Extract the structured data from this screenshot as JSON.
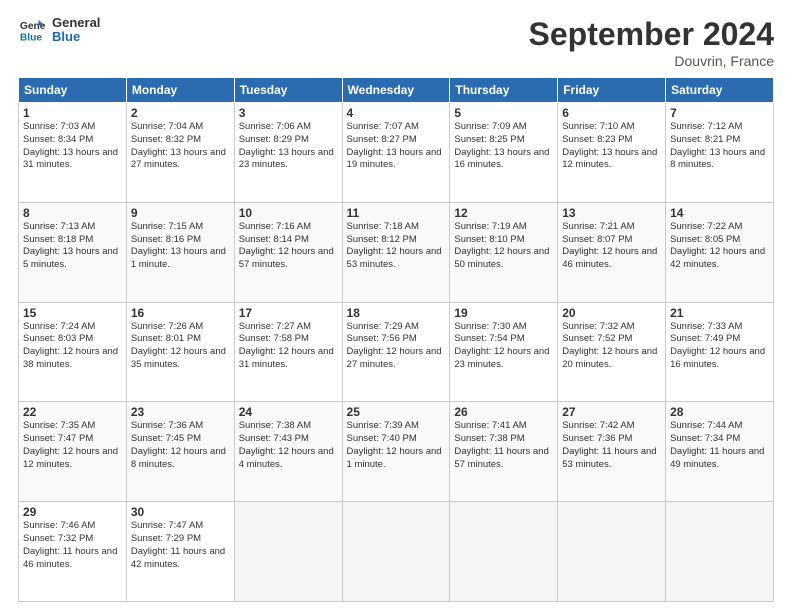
{
  "header": {
    "logo_line1": "General",
    "logo_line2": "Blue",
    "month": "September 2024",
    "location": "Douvrin, France"
  },
  "weekdays": [
    "Sunday",
    "Monday",
    "Tuesday",
    "Wednesday",
    "Thursday",
    "Friday",
    "Saturday"
  ],
  "weeks": [
    [
      {
        "day": "1",
        "sunrise": "Sunrise: 7:03 AM",
        "sunset": "Sunset: 8:34 PM",
        "daylight": "Daylight: 13 hours and 31 minutes."
      },
      {
        "day": "2",
        "sunrise": "Sunrise: 7:04 AM",
        "sunset": "Sunset: 8:32 PM",
        "daylight": "Daylight: 13 hours and 27 minutes."
      },
      {
        "day": "3",
        "sunrise": "Sunrise: 7:06 AM",
        "sunset": "Sunset: 8:29 PM",
        "daylight": "Daylight: 13 hours and 23 minutes."
      },
      {
        "day": "4",
        "sunrise": "Sunrise: 7:07 AM",
        "sunset": "Sunset: 8:27 PM",
        "daylight": "Daylight: 13 hours and 19 minutes."
      },
      {
        "day": "5",
        "sunrise": "Sunrise: 7:09 AM",
        "sunset": "Sunset: 8:25 PM",
        "daylight": "Daylight: 13 hours and 16 minutes."
      },
      {
        "day": "6",
        "sunrise": "Sunrise: 7:10 AM",
        "sunset": "Sunset: 8:23 PM",
        "daylight": "Daylight: 13 hours and 12 minutes."
      },
      {
        "day": "7",
        "sunrise": "Sunrise: 7:12 AM",
        "sunset": "Sunset: 8:21 PM",
        "daylight": "Daylight: 13 hours and 8 minutes."
      }
    ],
    [
      {
        "day": "8",
        "sunrise": "Sunrise: 7:13 AM",
        "sunset": "Sunset: 8:18 PM",
        "daylight": "Daylight: 13 hours and 5 minutes."
      },
      {
        "day": "9",
        "sunrise": "Sunrise: 7:15 AM",
        "sunset": "Sunset: 8:16 PM",
        "daylight": "Daylight: 13 hours and 1 minute."
      },
      {
        "day": "10",
        "sunrise": "Sunrise: 7:16 AM",
        "sunset": "Sunset: 8:14 PM",
        "daylight": "Daylight: 12 hours and 57 minutes."
      },
      {
        "day": "11",
        "sunrise": "Sunrise: 7:18 AM",
        "sunset": "Sunset: 8:12 PM",
        "daylight": "Daylight: 12 hours and 53 minutes."
      },
      {
        "day": "12",
        "sunrise": "Sunrise: 7:19 AM",
        "sunset": "Sunset: 8:10 PM",
        "daylight": "Daylight: 12 hours and 50 minutes."
      },
      {
        "day": "13",
        "sunrise": "Sunrise: 7:21 AM",
        "sunset": "Sunset: 8:07 PM",
        "daylight": "Daylight: 12 hours and 46 minutes."
      },
      {
        "day": "14",
        "sunrise": "Sunrise: 7:22 AM",
        "sunset": "Sunset: 8:05 PM",
        "daylight": "Daylight: 12 hours and 42 minutes."
      }
    ],
    [
      {
        "day": "15",
        "sunrise": "Sunrise: 7:24 AM",
        "sunset": "Sunset: 8:03 PM",
        "daylight": "Daylight: 12 hours and 38 minutes."
      },
      {
        "day": "16",
        "sunrise": "Sunrise: 7:26 AM",
        "sunset": "Sunset: 8:01 PM",
        "daylight": "Daylight: 12 hours and 35 minutes."
      },
      {
        "day": "17",
        "sunrise": "Sunrise: 7:27 AM",
        "sunset": "Sunset: 7:58 PM",
        "daylight": "Daylight: 12 hours and 31 minutes."
      },
      {
        "day": "18",
        "sunrise": "Sunrise: 7:29 AM",
        "sunset": "Sunset: 7:56 PM",
        "daylight": "Daylight: 12 hours and 27 minutes."
      },
      {
        "day": "19",
        "sunrise": "Sunrise: 7:30 AM",
        "sunset": "Sunset: 7:54 PM",
        "daylight": "Daylight: 12 hours and 23 minutes."
      },
      {
        "day": "20",
        "sunrise": "Sunrise: 7:32 AM",
        "sunset": "Sunset: 7:52 PM",
        "daylight": "Daylight: 12 hours and 20 minutes."
      },
      {
        "day": "21",
        "sunrise": "Sunrise: 7:33 AM",
        "sunset": "Sunset: 7:49 PM",
        "daylight": "Daylight: 12 hours and 16 minutes."
      }
    ],
    [
      {
        "day": "22",
        "sunrise": "Sunrise: 7:35 AM",
        "sunset": "Sunset: 7:47 PM",
        "daylight": "Daylight: 12 hours and 12 minutes."
      },
      {
        "day": "23",
        "sunrise": "Sunrise: 7:36 AM",
        "sunset": "Sunset: 7:45 PM",
        "daylight": "Daylight: 12 hours and 8 minutes."
      },
      {
        "day": "24",
        "sunrise": "Sunrise: 7:38 AM",
        "sunset": "Sunset: 7:43 PM",
        "daylight": "Daylight: 12 hours and 4 minutes."
      },
      {
        "day": "25",
        "sunrise": "Sunrise: 7:39 AM",
        "sunset": "Sunset: 7:40 PM",
        "daylight": "Daylight: 12 hours and 1 minute."
      },
      {
        "day": "26",
        "sunrise": "Sunrise: 7:41 AM",
        "sunset": "Sunset: 7:38 PM",
        "daylight": "Daylight: 11 hours and 57 minutes."
      },
      {
        "day": "27",
        "sunrise": "Sunrise: 7:42 AM",
        "sunset": "Sunset: 7:36 PM",
        "daylight": "Daylight: 11 hours and 53 minutes."
      },
      {
        "day": "28",
        "sunrise": "Sunrise: 7:44 AM",
        "sunset": "Sunset: 7:34 PM",
        "daylight": "Daylight: 11 hours and 49 minutes."
      }
    ],
    [
      {
        "day": "29",
        "sunrise": "Sunrise: 7:46 AM",
        "sunset": "Sunset: 7:32 PM",
        "daylight": "Daylight: 11 hours and 46 minutes."
      },
      {
        "day": "30",
        "sunrise": "Sunrise: 7:47 AM",
        "sunset": "Sunset: 7:29 PM",
        "daylight": "Daylight: 11 hours and 42 minutes."
      },
      null,
      null,
      null,
      null,
      null
    ]
  ]
}
